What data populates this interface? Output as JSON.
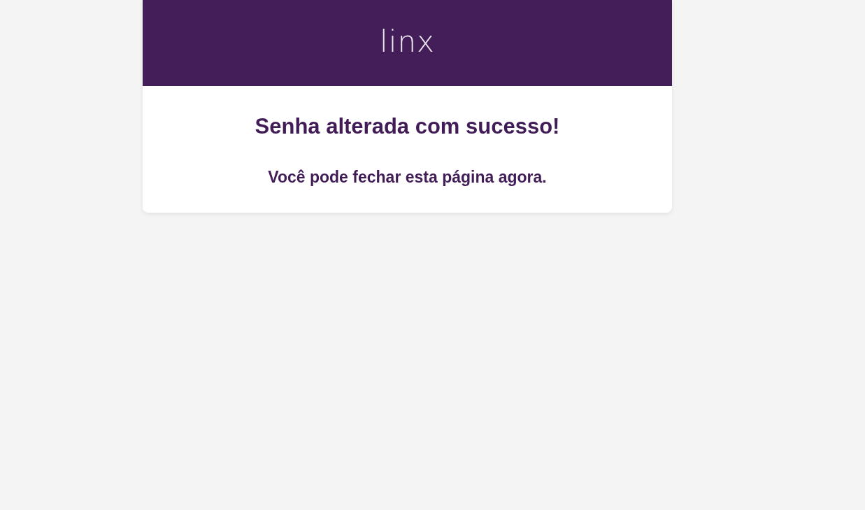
{
  "header": {
    "logo": "linx"
  },
  "message": {
    "title": "Senha alterada com sucesso!",
    "subtitle": "Você pode fechar esta página agora."
  }
}
